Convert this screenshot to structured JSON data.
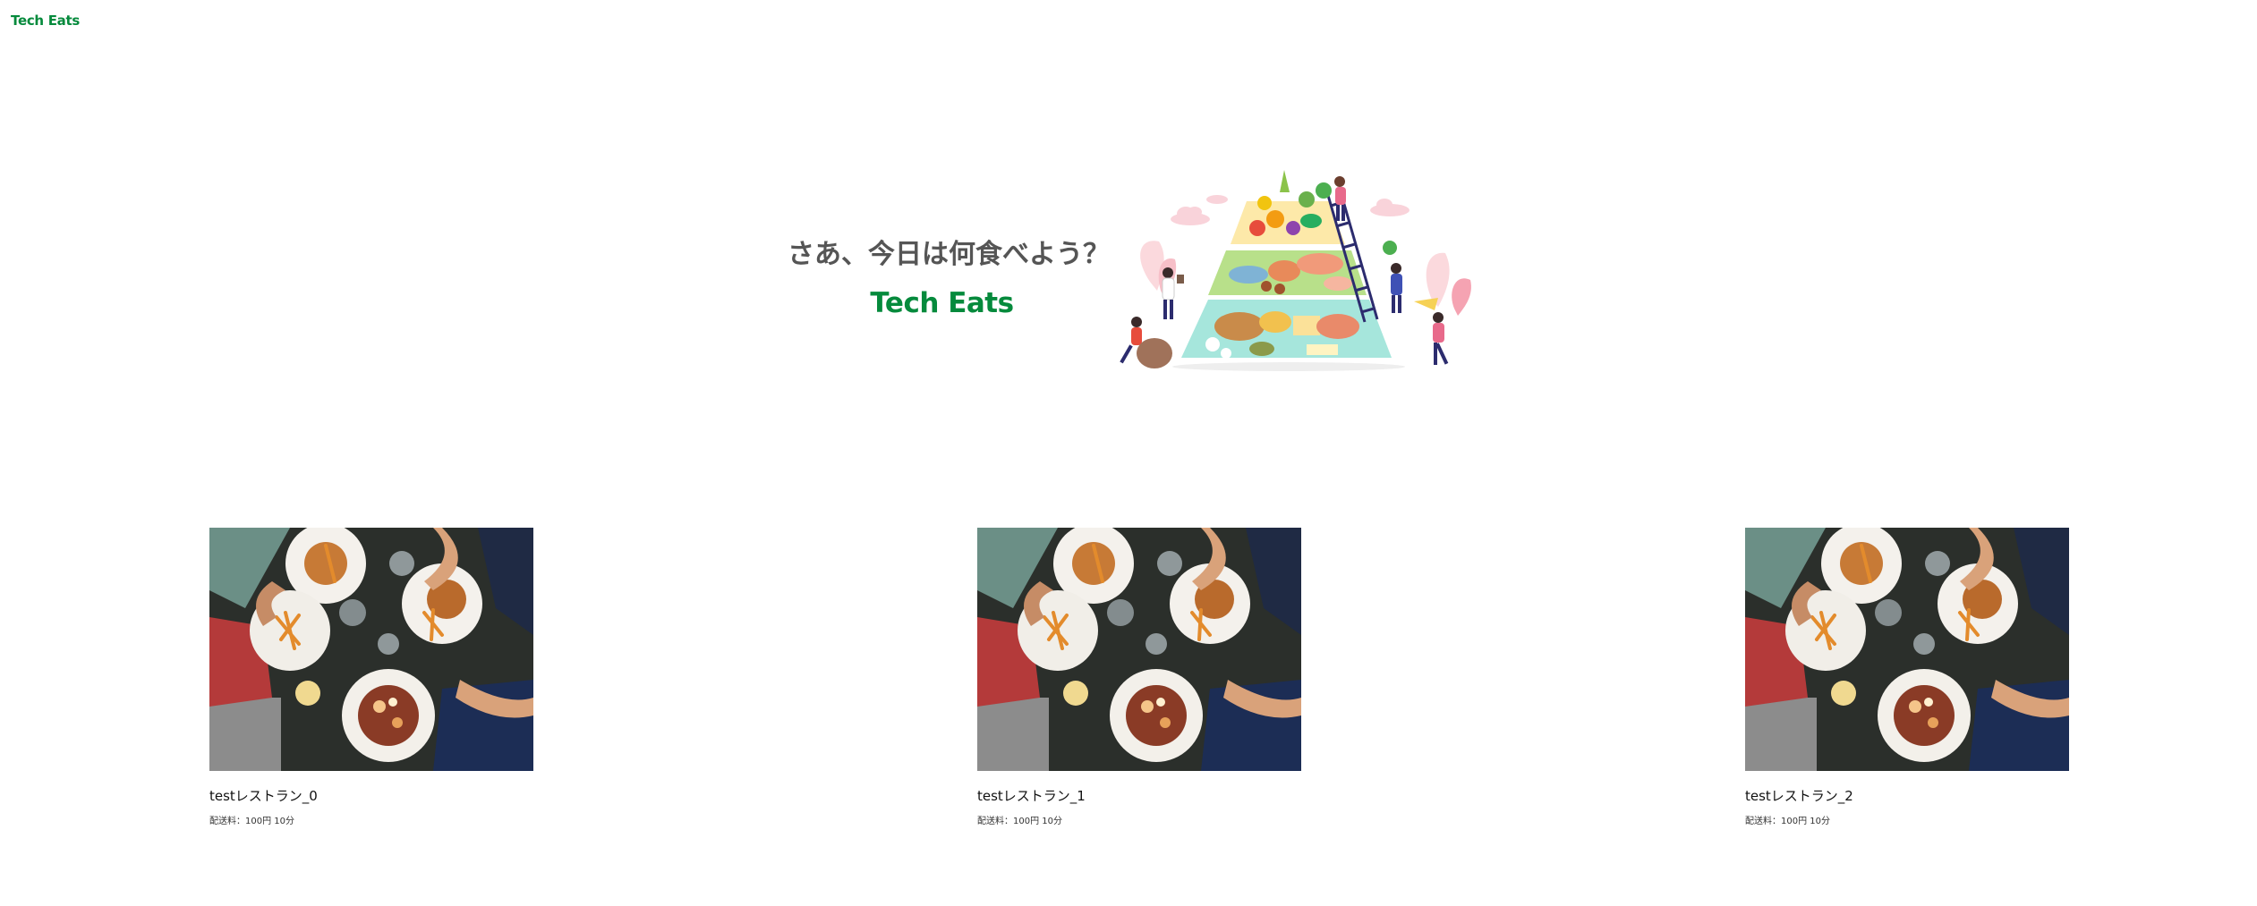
{
  "header": {
    "logo_text": "Tech Eats"
  },
  "hero": {
    "catch_text": "さあ、今日は何食べよう？",
    "logo_text": "Tech Eats",
    "illustration_icon": "food-pyramid-illustration"
  },
  "restaurants": [
    {
      "name": "testレストラン_0",
      "meta": "配送料：100円 10分",
      "image_icon": "restaurant-food-photo"
    },
    {
      "name": "testレストラン_1",
      "meta": "配送料：100円 10分",
      "image_icon": "restaurant-food-photo"
    },
    {
      "name": "testレストラン_2",
      "meta": "配送料：100円 10分",
      "image_icon": "restaurant-food-photo"
    }
  ],
  "colors": {
    "brand_green": "#058a3c",
    "catch_gray": "#555555"
  }
}
